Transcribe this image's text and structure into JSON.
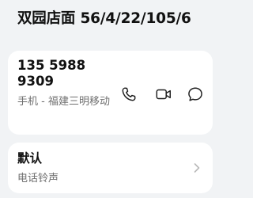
{
  "header": {
    "title": "双园店面 56/4/22/105/6"
  },
  "contact": {
    "phone_number": "135 5988 9309",
    "location": "手机 - 福建三明移动",
    "actions": [
      {
        "name": "call",
        "icon": "phone-icon"
      },
      {
        "name": "video",
        "icon": "video-camera-icon"
      },
      {
        "name": "message",
        "icon": "message-bubble-icon"
      }
    ]
  },
  "ringtone": {
    "value": "默认",
    "label": "电话铃声",
    "icon": "chevron-right-icon"
  }
}
